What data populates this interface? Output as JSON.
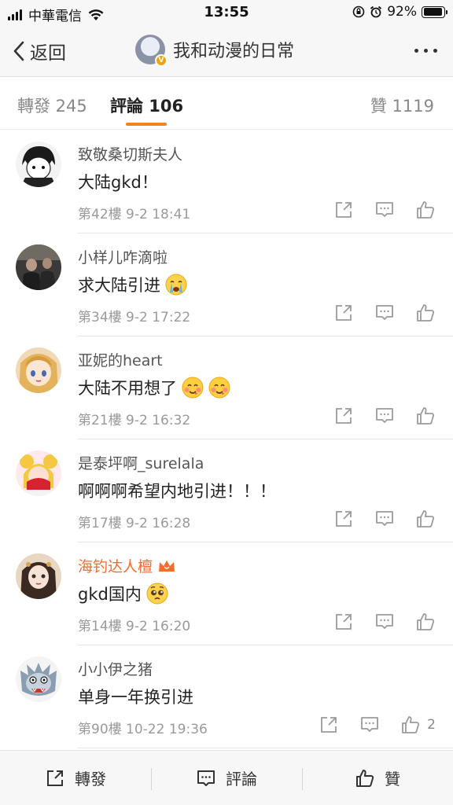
{
  "status_bar": {
    "carrier": "中華電信",
    "time": "13:55",
    "battery_percent": "92%",
    "battery_level": 0.92
  },
  "nav": {
    "back_label": "返回",
    "title": "我和动漫的日常",
    "verified_badge": "V"
  },
  "tabs": {
    "repost": "轉發 245",
    "comments": "評論 106",
    "likes": "贊 1119"
  },
  "comments": [
    {
      "name": "致敬桑切斯夫人",
      "text": "大陆gkd！",
      "emoji": [],
      "meta": "第42樓  9-2 18:41",
      "likes": "",
      "vip": false,
      "avatar_icon": "boy-anime-avatar"
    },
    {
      "name": "小样儿咋滴啦",
      "text": "求大陆引进",
      "emoji": [
        "crying-face-emoji"
      ],
      "meta": "第34樓  9-2 17:22",
      "likes": "",
      "vip": false,
      "avatar_icon": "dark-photo-avatar"
    },
    {
      "name": "亚妮的heart",
      "text": "大陆不用想了",
      "emoji": [
        "hungry-face-emoji",
        "hungry-face-emoji"
      ],
      "meta": "第21樓  9-2 16:32",
      "likes": "",
      "vip": false,
      "avatar_icon": "anime-girl-avatar"
    },
    {
      "name": "是泰坪啊_surelala",
      "text": "啊啊啊希望内地引进！！！",
      "emoji": [],
      "meta": "第17樓  9-2 16:28",
      "likes": "",
      "vip": false,
      "avatar_icon": "sailor-moon-avatar"
    },
    {
      "name": "海钓达人檀",
      "text": "gkd国内",
      "emoji": [
        "pleading-face-emoji"
      ],
      "meta": "第14樓  9-2 16:20",
      "likes": "",
      "vip": true,
      "avatar_icon": "doll-avatar"
    },
    {
      "name": "小小伊之猪",
      "text": "单身一年换引进",
      "emoji": [],
      "meta": "第90樓  10-22 19:36",
      "likes": "2",
      "vip": false,
      "avatar_icon": "boar-mask-avatar"
    }
  ],
  "bottom_bar": {
    "repost": "轉發",
    "comment": "評論",
    "like": "贊"
  },
  "colors": {
    "accent": "#f08419",
    "vip_name": "#f86c2c",
    "meta": "#9a9a9a"
  }
}
